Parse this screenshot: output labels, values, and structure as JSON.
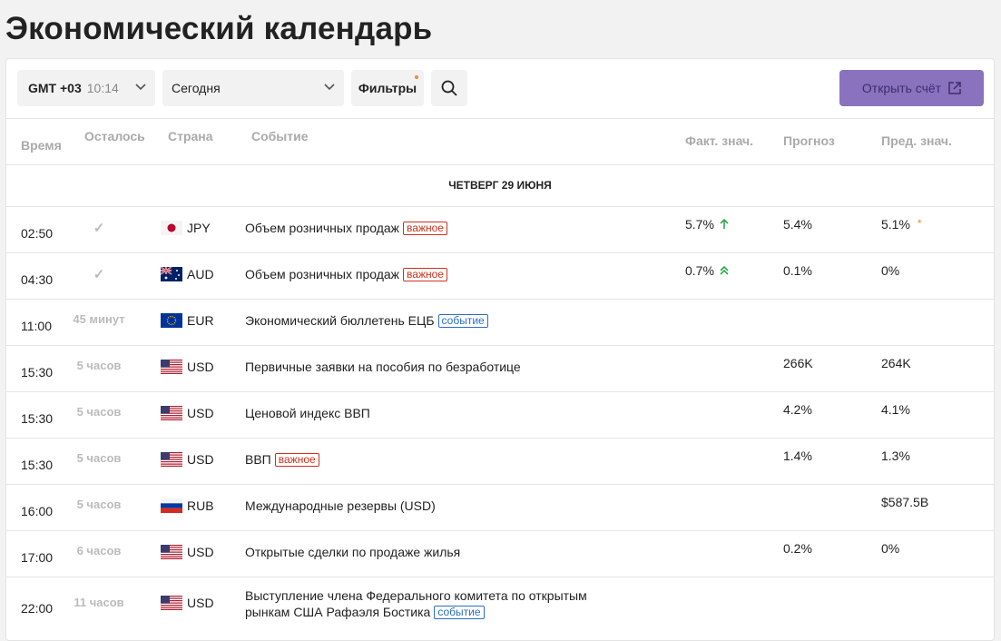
{
  "page_title": "Экономический календарь",
  "toolbar": {
    "timezone": "GMT +03",
    "clock": "10:14",
    "date_select": "Сегодня",
    "filters_label": "Фильтры",
    "open_account_label": "Открыть счёт"
  },
  "table": {
    "headers": {
      "time": "Время",
      "left": "Осталось",
      "country": "Страна",
      "event": "Событие",
      "actual": "Факт. знач.",
      "forecast": "Прогноз",
      "previous": "Пред. знач."
    },
    "day_label": "ЧЕТВЕРГ 29 ИЮНЯ",
    "rows": [
      {
        "time": "02:50",
        "left": "✓",
        "currency": "JPY",
        "flag": "jp",
        "event": "Объем розничных продаж",
        "tag": "важное",
        "actual": "5.7%",
        "forecast": "5.4%",
        "previous": "5.1%"
      },
      {
        "time": "04:30",
        "left": "✓",
        "currency": "AUD",
        "flag": "au",
        "event": "Объем розничных продаж",
        "tag": "важное",
        "actual": "0.7%",
        "forecast": "0.1%",
        "previous": "0%"
      },
      {
        "time": "11:00",
        "left": "45 минут",
        "currency": "EUR",
        "flag": "eu",
        "event": "Экономический бюллетень ЕЦБ",
        "tag": "событие",
        "actual": "",
        "forecast": "",
        "previous": ""
      },
      {
        "time": "15:30",
        "left": "5 часов",
        "currency": "USD",
        "flag": "us",
        "event": "Первичные заявки на пособия по безработице",
        "tag": "",
        "actual": "",
        "forecast": "266K",
        "previous": "264K"
      },
      {
        "time": "15:30",
        "left": "5 часов",
        "currency": "USD",
        "flag": "us",
        "event": "Ценовой индекс ВВП",
        "tag": "",
        "actual": "",
        "forecast": "4.2%",
        "previous": "4.1%"
      },
      {
        "time": "15:30",
        "left": "5 часов",
        "currency": "USD",
        "flag": "us",
        "event": "ВВП",
        "tag": "важное",
        "actual": "",
        "forecast": "1.4%",
        "previous": "1.3%"
      },
      {
        "time": "16:00",
        "left": "5 часов",
        "currency": "RUB",
        "flag": "ru",
        "event": "Международные резервы (USD)",
        "tag": "",
        "actual": "",
        "forecast": "",
        "previous": "$587.5B"
      },
      {
        "time": "17:00",
        "left": "6 часов",
        "currency": "USD",
        "flag": "us",
        "event": "Открытые сделки по продаже жилья",
        "tag": "",
        "actual": "",
        "forecast": "0.2%",
        "previous": "0%"
      },
      {
        "time": "22:00",
        "left": "11 часов",
        "currency": "USD",
        "flag": "us",
        "event": "Выступление члена Федерального комитета по открытым рынкам США Рафаэля Бостика",
        "tag": "событие",
        "actual": "",
        "forecast": "",
        "previous": ""
      }
    ]
  }
}
